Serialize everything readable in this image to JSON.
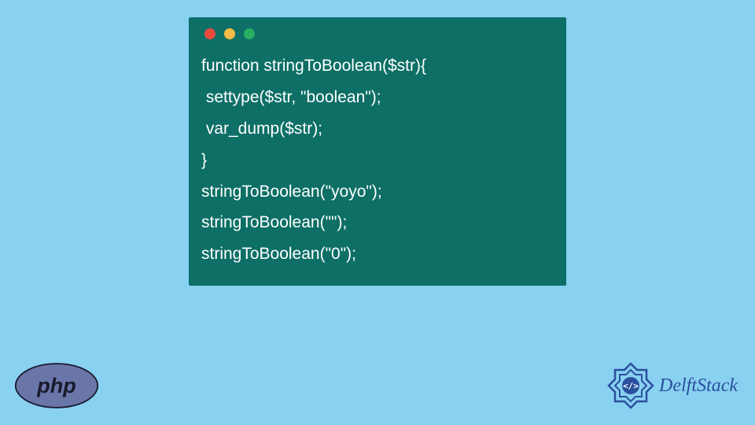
{
  "code": {
    "lines": [
      "function stringToBoolean($str){",
      " settype($str, \"boolean\");",
      " var_dump($str);",
      "}",
      "stringToBoolean(\"yoyo\");",
      "stringToBoolean(\"\");",
      "stringToBoolean(\"0\");"
    ]
  },
  "icons": {
    "php_label": "php",
    "brand_name": "DelftStack"
  },
  "colors": {
    "page_bg": "#88d1f1",
    "window_bg": "#0d6f66",
    "code_text": "#ffffff",
    "dot_red": "#e94b3c",
    "dot_yellow": "#f5bd45",
    "dot_green": "#27ae60",
    "php_fill": "#6a76a8",
    "brand_blue": "#2b4f9e"
  }
}
